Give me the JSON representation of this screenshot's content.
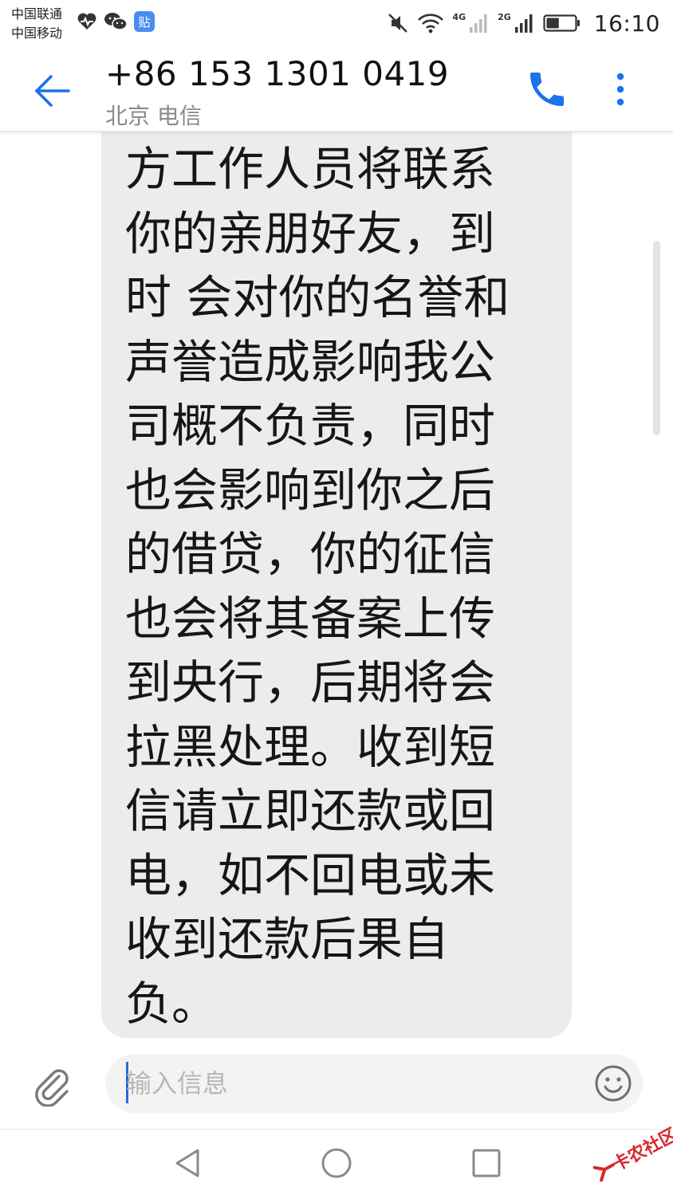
{
  "status_bar": {
    "carrier_1": "中国联通",
    "carrier_2": "中国移动",
    "network_1": "4G",
    "network_2": "2G",
    "time": "16:10",
    "icons": [
      "heart-rate-icon",
      "wechat-icon",
      "tieba-icon",
      "mute-icon",
      "wifi-icon",
      "signal-icon",
      "battery-icon"
    ],
    "battery_level": 0.45
  },
  "header": {
    "contact_number": "+86 153 1301 0419",
    "contact_location": "北京 电信",
    "icons": [
      "back-arrow-icon",
      "phone-icon",
      "more-vert-icon"
    ],
    "accent_color": "#1a73e8"
  },
  "conversation": {
    "message_text": "方工作人员将联系你的亲朋好友，到时 会对你的名誉和声誉造成影响我公司概不负责，同时也会影响到你之后的借贷，你的征信也会将其备案上传到央行，后期将会拉黑处理。收到短信请立即还款或回电，如不回电或未收到还款后果自负。",
    "bubble_color": "#ececec"
  },
  "composer": {
    "placeholder": "输入信息",
    "value": "",
    "icons": [
      "paperclip-icon",
      "emoji-icon"
    ]
  },
  "nav_bar": {
    "icons": [
      "nav-back-icon",
      "nav-home-icon",
      "nav-recent-icon"
    ]
  },
  "watermark": {
    "text": "卡农社区",
    "color": "#d9262c"
  }
}
